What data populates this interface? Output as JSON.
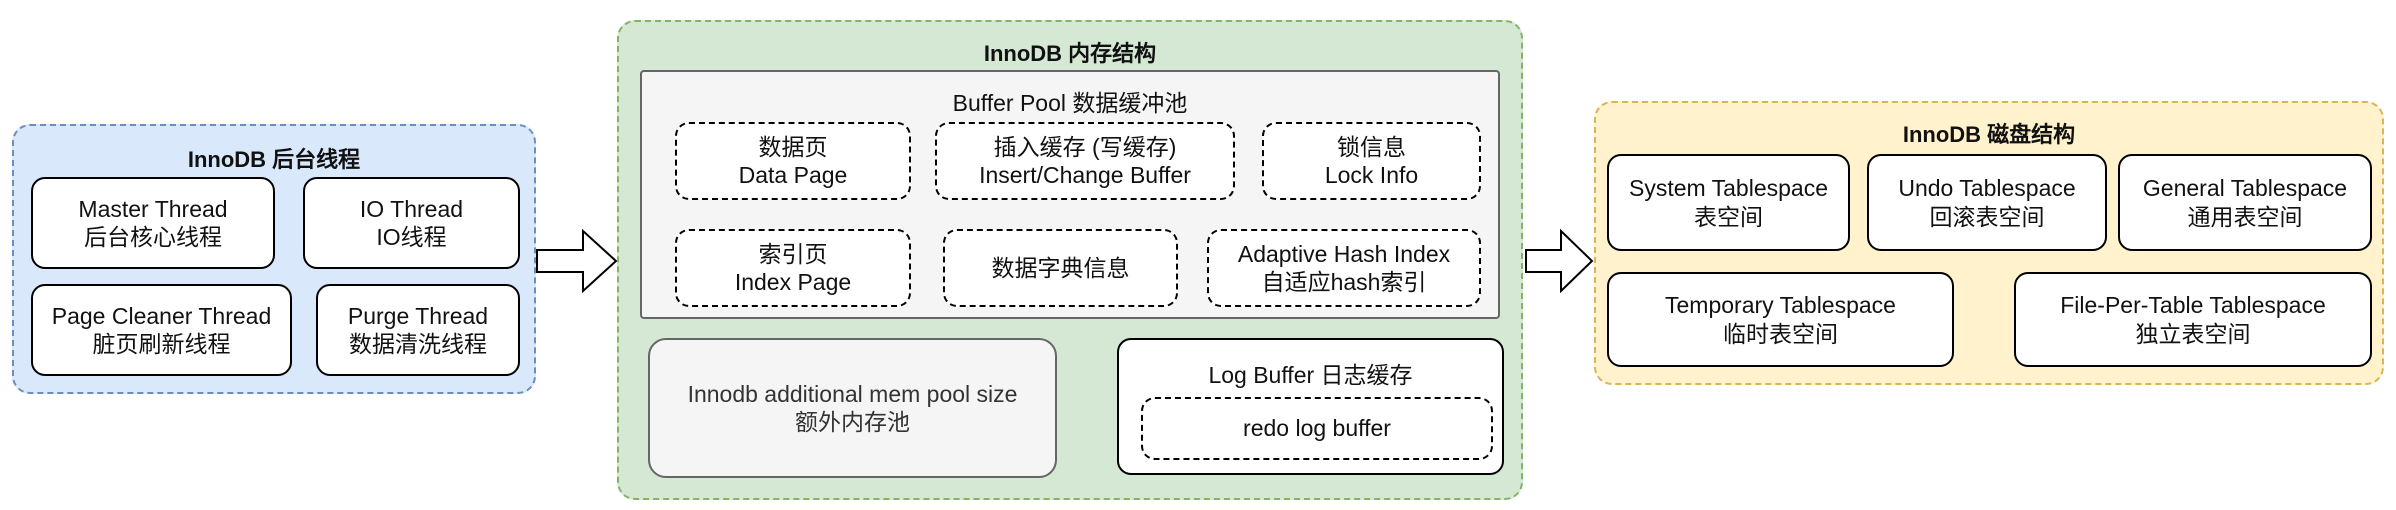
{
  "colors": {
    "threads_fill": "#dae8fc",
    "threads_border": "#6c8ebf",
    "memory_fill": "#d5e8d4",
    "memory_border": "#82b366",
    "disk_fill": "#fff2cc",
    "disk_border": "#d6b656",
    "inner_fill": "#f5f5f5",
    "inner_border": "#666666"
  },
  "threads": {
    "title": "InnoDB 后台线程",
    "items": [
      {
        "en": "Master Thread",
        "zh": "后台核心线程"
      },
      {
        "en": "IO Thread",
        "zh": "IO线程"
      },
      {
        "en": "Page Cleaner Thread",
        "zh": "脏页刷新线程"
      },
      {
        "en": "Purge Thread",
        "zh": "数据清洗线程"
      }
    ]
  },
  "memory": {
    "title": "InnoDB 内存结构",
    "buffer_pool": {
      "title": "Buffer Pool 数据缓冲池",
      "items": [
        {
          "line1": "数据页",
          "line2": "Data Page"
        },
        {
          "line1": "插入缓存 (写缓存)",
          "line2": "Insert/Change Buffer"
        },
        {
          "line1": "锁信息",
          "line2": "Lock Info"
        },
        {
          "line1": "索引页",
          "line2": "Index Page"
        },
        {
          "line1": "数据字典信息"
        },
        {
          "line1": "Adaptive Hash Index",
          "line2": "自适应hash索引"
        }
      ]
    },
    "additional_pool": {
      "en": "Innodb additional mem pool size",
      "zh": "额外内存池"
    },
    "log_buffer": {
      "title": "Log Buffer 日志缓存",
      "redo": "redo log buffer"
    }
  },
  "disk": {
    "title": "InnoDB 磁盘结构",
    "items": [
      {
        "en": "System Tablespace",
        "zh": "表空间"
      },
      {
        "en": "Undo Tablespace",
        "zh": "回滚表空间"
      },
      {
        "en": "General Tablespace",
        "zh": "通用表空间"
      },
      {
        "en": "Temporary Tablespace",
        "zh": "临时表空间"
      },
      {
        "en": "File-Per-Table Tablespace",
        "zh": "独立表空间"
      }
    ]
  }
}
